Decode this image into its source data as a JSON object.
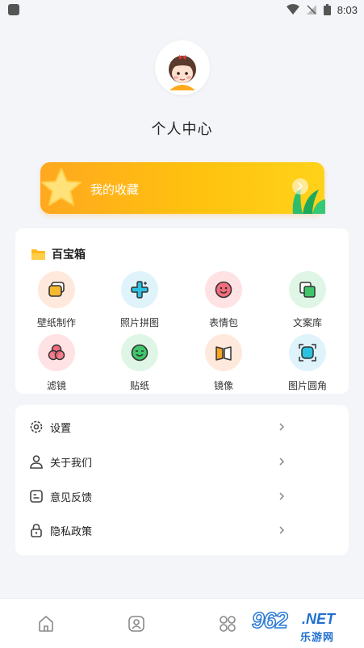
{
  "status_bar": {
    "time": "8:03"
  },
  "profile": {
    "title": "个人中心"
  },
  "favorites": {
    "label": "我的收藏"
  },
  "toolbox": {
    "title": "百宝箱",
    "tools": [
      {
        "label": "壁纸制作",
        "icon": "wallpaper-icon",
        "bg": "#ffe8dc",
        "color": "#f5a623"
      },
      {
        "label": "照片拼图",
        "icon": "collage-icon",
        "bg": "#dff3fb",
        "color": "#2bc1e0"
      },
      {
        "label": "表情包",
        "icon": "emoji-icon",
        "bg": "#ffe2e4",
        "color": "#f26d7d"
      },
      {
        "label": "文案库",
        "icon": "copy-library-icon",
        "bg": "#dff6e6",
        "color": "#3fc66b"
      },
      {
        "label": "滤镜",
        "icon": "filter-icon",
        "bg": "#ffe2e4",
        "color": "#f26d7d"
      },
      {
        "label": "贴纸",
        "icon": "sticker-icon",
        "bg": "#dff6e6",
        "color": "#3fc66b"
      },
      {
        "label": "镜像",
        "icon": "mirror-icon",
        "bg": "#ffe8dc",
        "color": "#f5a623"
      },
      {
        "label": "图片圆角",
        "icon": "round-corner-icon",
        "bg": "#dff3fb",
        "color": "#2bc1e0"
      }
    ]
  },
  "menu": [
    {
      "label": "设置",
      "icon": "gear-icon"
    },
    {
      "label": "关于我们",
      "icon": "user-icon"
    },
    {
      "label": "意见反馈",
      "icon": "feedback-icon"
    },
    {
      "label": "隐私政策",
      "icon": "lock-icon"
    }
  ],
  "watermark": {
    "number": "962",
    "domain": ".NET",
    "text": "乐游网"
  },
  "colors": {
    "accent": "#ffb81c",
    "background": "#f4f5f9"
  }
}
